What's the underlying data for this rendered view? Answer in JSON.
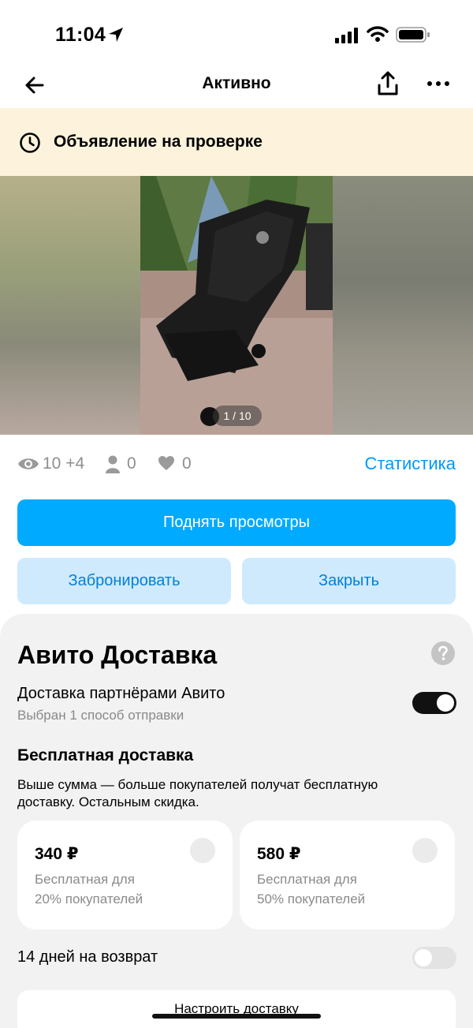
{
  "status_bar": {
    "time": "11:04"
  },
  "nav": {
    "title": "Активно"
  },
  "banner": {
    "text": "Объявление на проверке"
  },
  "photo": {
    "counter": "1 / 10"
  },
  "stats": {
    "views": "10 +4",
    "contacts": "0",
    "favorites": "0",
    "link": "Статистика"
  },
  "actions": {
    "primary": "Поднять просмотры",
    "reserve": "Забронировать",
    "close": "Закрыть"
  },
  "delivery": {
    "title": "Авито Доставка",
    "partner_title": "Доставка партнёрами Авито",
    "partner_sub": "Выбран 1 способ отправки",
    "partner_enabled": true,
    "free_title": "Бесплатная доставка",
    "free_desc": "Выше сумма — больше покупателей получат бесплатную доставку. Остальным скидка.",
    "options": [
      {
        "price": "340 ₽",
        "line1": "Бесплатная для",
        "line2": "20% покупателей"
      },
      {
        "price": "580 ₽",
        "line1": "Бесплатная для",
        "line2": "50% покупателей"
      }
    ],
    "return_label": "14 дней на возврат",
    "return_enabled": false,
    "setup_label": "Настроить доставку"
  },
  "colors": {
    "accent": "#00aaff",
    "link": "#0099f7",
    "secondary_bg": "#cfeafc",
    "banner_bg": "#fdf3dc"
  }
}
